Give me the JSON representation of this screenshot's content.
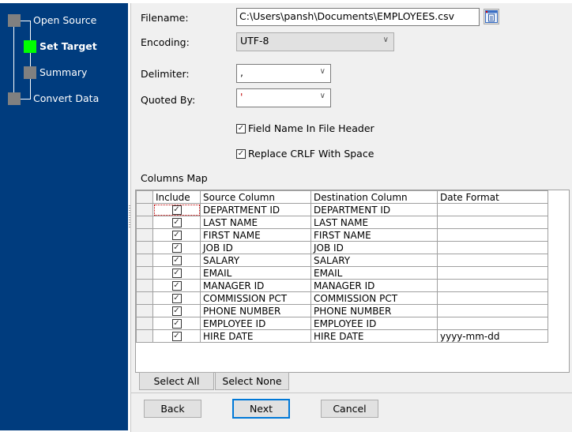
{
  "wizard": {
    "steps": [
      {
        "label": "Open Source",
        "state": "done"
      },
      {
        "label": "Set Target",
        "state": "active"
      },
      {
        "label": "Summary",
        "state": "pending"
      },
      {
        "label": "Convert Data",
        "state": "pending"
      }
    ],
    "colors": {
      "sidebar_bg": "#003c7e",
      "active_step": "#00ff00",
      "inactive_step": "#808080"
    }
  },
  "form": {
    "filename_label": "Filename:",
    "filename_value": "C:\\Users\\pansh\\Documents\\EMPLOYEES.csv",
    "browse_icon": "browse-file-icon",
    "encoding_label": "Encoding:",
    "encoding_value": "UTF-8",
    "delimiter_label": "Delimiter:",
    "delimiter_value": ",",
    "quoted_by_label": "Quoted By:",
    "quoted_by_value": "'",
    "field_name_header_label": "Field Name In File Header",
    "field_name_header_checked": true,
    "replace_crlf_label": "Replace CRLF With Space",
    "replace_crlf_checked": true
  },
  "columns_map": {
    "title": "Columns Map",
    "headers": [
      "Include",
      "Source Column",
      "Destination Column",
      "Date Format"
    ],
    "rows": [
      {
        "include": true,
        "source": "DEPARTMENT ID",
        "destination": "DEPARTMENT ID",
        "date_format": ""
      },
      {
        "include": true,
        "source": "LAST NAME",
        "destination": "LAST NAME",
        "date_format": ""
      },
      {
        "include": true,
        "source": "FIRST NAME",
        "destination": "FIRST NAME",
        "date_format": ""
      },
      {
        "include": true,
        "source": "JOB ID",
        "destination": "JOB ID",
        "date_format": ""
      },
      {
        "include": true,
        "source": "SALARY",
        "destination": "SALARY",
        "date_format": ""
      },
      {
        "include": true,
        "source": "EMAIL",
        "destination": "EMAIL",
        "date_format": ""
      },
      {
        "include": true,
        "source": "MANAGER ID",
        "destination": "MANAGER ID",
        "date_format": ""
      },
      {
        "include": true,
        "source": "COMMISSION PCT",
        "destination": "COMMISSION PCT",
        "date_format": ""
      },
      {
        "include": true,
        "source": "PHONE NUMBER",
        "destination": "PHONE NUMBER",
        "date_format": ""
      },
      {
        "include": true,
        "source": "EMPLOYEE ID",
        "destination": "EMPLOYEE ID",
        "date_format": ""
      },
      {
        "include": true,
        "source": "HIRE DATE",
        "destination": "HIRE DATE",
        "date_format": "yyyy-mm-dd"
      }
    ],
    "select_all_label": "Select All",
    "select_none_label": "Select None"
  },
  "footer": {
    "back_label": "Back",
    "next_label": "Next",
    "cancel_label": "Cancel"
  },
  "glyphs": {
    "check": "✓",
    "chevron": "∨"
  }
}
